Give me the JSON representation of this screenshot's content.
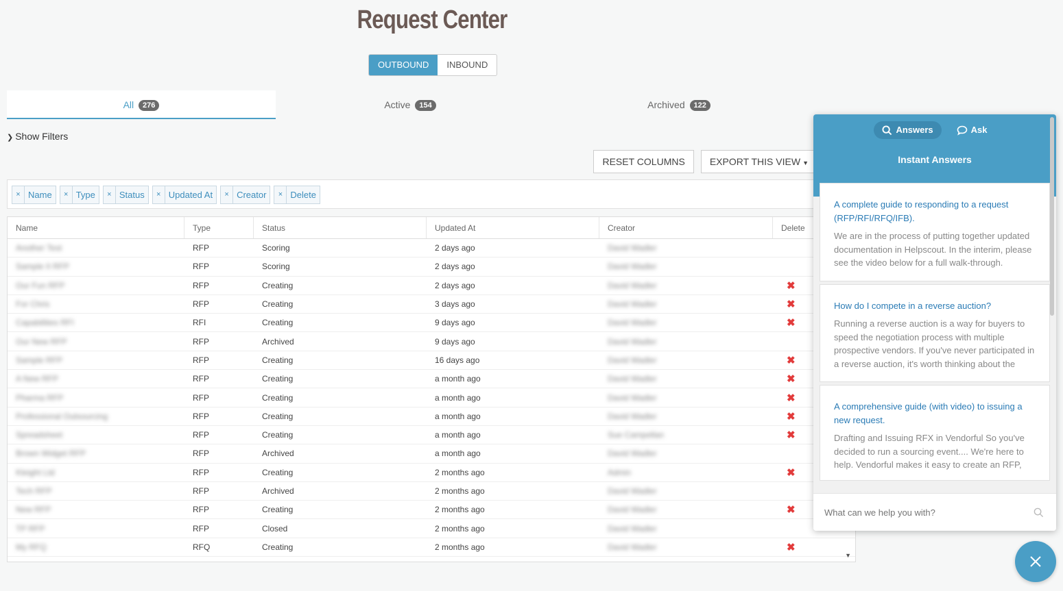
{
  "page": {
    "title": "Request Center"
  },
  "direction_toggle": {
    "outbound": "OUTBOUND",
    "inbound": "INBOUND",
    "selected": "OUTBOUND"
  },
  "tabs": [
    {
      "label": "All",
      "count": "276",
      "active": true
    },
    {
      "label": "Active",
      "count": "154",
      "active": false
    },
    {
      "label": "Archived",
      "count": "122",
      "active": false
    }
  ],
  "filters": {
    "show_label": "Show Filters"
  },
  "toolbar": {
    "reset_columns": "RESET COLUMNS",
    "export_view": "EXPORT THIS VIEW"
  },
  "column_chips": [
    "Name",
    "Type",
    "Status",
    "Updated At",
    "Creator",
    "Delete"
  ],
  "table": {
    "headers": [
      "Name",
      "Type",
      "Status",
      "Updated At",
      "Creator",
      "Delete"
    ],
    "rows": [
      {
        "name": "Another Test",
        "type": "RFP",
        "status": "Scoring",
        "updated": "2 days ago",
        "creator": "David Wadler",
        "deletable": false
      },
      {
        "name": "Sample II RFP",
        "type": "RFP",
        "status": "Scoring",
        "updated": "2 days ago",
        "creator": "David Wadler",
        "deletable": false
      },
      {
        "name": "Our Fun RFP",
        "type": "RFP",
        "status": "Creating",
        "updated": "2 days ago",
        "creator": "David Wadler",
        "deletable": true
      },
      {
        "name": "For Chris",
        "type": "RFP",
        "status": "Creating",
        "updated": "3 days ago",
        "creator": "David Wadler",
        "deletable": true
      },
      {
        "name": "Capabilities RFI",
        "type": "RFI",
        "status": "Creating",
        "updated": "9 days ago",
        "creator": "David Wadler",
        "deletable": true
      },
      {
        "name": "Our New RFP",
        "type": "RFP",
        "status": "Archived",
        "updated": "9 days ago",
        "creator": "David Wadler",
        "deletable": false
      },
      {
        "name": "Sample RFP",
        "type": "RFP",
        "status": "Creating",
        "updated": "16 days ago",
        "creator": "David Wadler",
        "deletable": true
      },
      {
        "name": "A New RFP",
        "type": "RFP",
        "status": "Creating",
        "updated": "a month ago",
        "creator": "David Wadler",
        "deletable": true
      },
      {
        "name": "Pharma RFP",
        "type": "RFP",
        "status": "Creating",
        "updated": "a month ago",
        "creator": "David Wadler",
        "deletable": true
      },
      {
        "name": "Professional Outsourcing",
        "type": "RFP",
        "status": "Creating",
        "updated": "a month ago",
        "creator": "David Wadler",
        "deletable": true
      },
      {
        "name": "Spreadsheet",
        "type": "RFP",
        "status": "Creating",
        "updated": "a month ago",
        "creator": "Sue Campellan",
        "deletable": true
      },
      {
        "name": "Brown Widget RFP",
        "type": "RFP",
        "status": "Archived",
        "updated": "a month ago",
        "creator": "David Wadler",
        "deletable": false
      },
      {
        "name": "Kleight Ltd",
        "type": "RFP",
        "status": "Creating",
        "updated": "2 months ago",
        "creator": "Admin",
        "deletable": true
      },
      {
        "name": "Tech RFP",
        "type": "RFP",
        "status": "Archived",
        "updated": "2 months ago",
        "creator": "David Wadler",
        "deletable": false
      },
      {
        "name": "New RFP",
        "type": "RFP",
        "status": "Creating",
        "updated": "2 months ago",
        "creator": "David Wadler",
        "deletable": true
      },
      {
        "name": "TP RFP",
        "type": "RFP",
        "status": "Closed",
        "updated": "2 months ago",
        "creator": "David Wadler",
        "deletable": false
      },
      {
        "name": "My RFQ",
        "type": "RFQ",
        "status": "Creating",
        "updated": "2 months ago",
        "creator": "David Wadler",
        "deletable": true
      }
    ]
  },
  "help_widget": {
    "tab_answers": "Answers",
    "tab_ask": "Ask",
    "title": "Instant Answers",
    "articles": [
      {
        "title": "A complete guide to responding to a request (RFP/RFI/RFQ/IFB).",
        "excerpt": "We are in the process of putting together updated documentation in Helpscout. In the interim, please see the video below for a full walk-through."
      },
      {
        "title": "How do I compete in a reverse auction?",
        "excerpt": "Running a reverse auction is a way for buyers to speed the negotiation process with multiple prospective vendors. If you've never participated in a reverse auction, it's worth thinking about the"
      },
      {
        "title": "A comprehensive guide (with video) to issuing a new request.",
        "excerpt": "Drafting and Issuing RFX in Vendorful So you've decided to run a sourcing event.... We're here to help. Vendorful makes it easy to create an RFP,"
      }
    ],
    "search_placeholder": "What can we help you with?"
  },
  "colors": {
    "accent": "#4a9ec6",
    "delete": "#e23b3b",
    "title": "#6b5a55"
  }
}
